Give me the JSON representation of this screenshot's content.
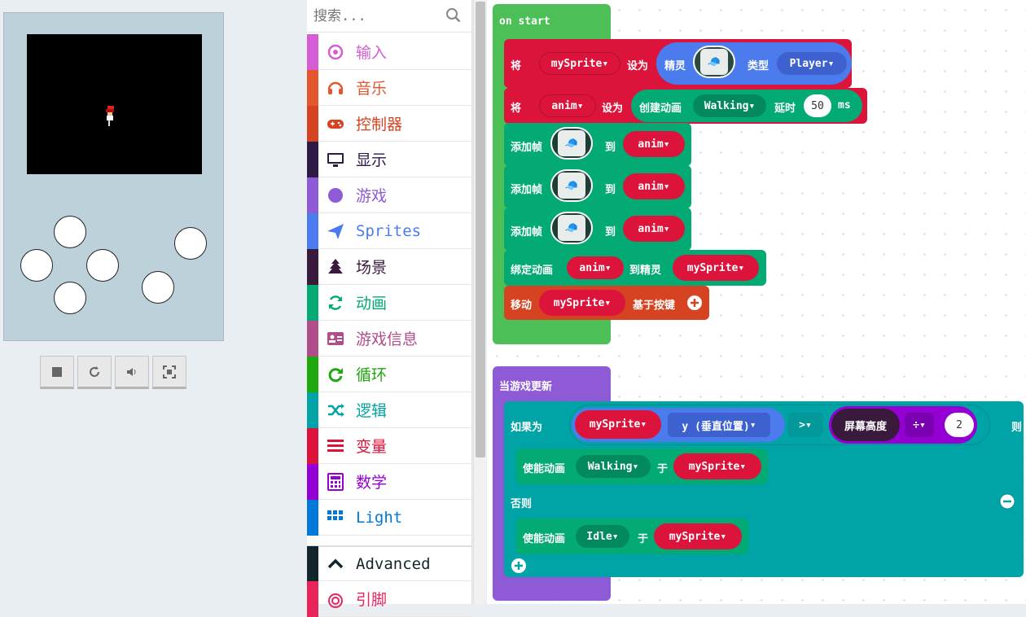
{
  "search": {
    "placeholder": "搜索..."
  },
  "categories": [
    {
      "label": "输入",
      "color": "#d65cd6",
      "icon": "target-icon"
    },
    {
      "label": "音乐",
      "color": "#e4572e",
      "icon": "headphones-icon"
    },
    {
      "label": "控制器",
      "color": "#d54322",
      "icon": "gamepad-icon"
    },
    {
      "label": "显示",
      "color": "#2d1a45",
      "icon": "monitor-icon"
    },
    {
      "label": "游戏",
      "color": "#8e5ad6",
      "icon": "circle-icon"
    },
    {
      "label": "Sprites",
      "color": "#4b7bec",
      "icon": "paper-plane-icon"
    },
    {
      "label": "场景",
      "color": "#3a1a3c",
      "icon": "tree-icon"
    },
    {
      "label": "动画",
      "color": "#03aa74",
      "icon": "refresh-icon"
    },
    {
      "label": "游戏信息",
      "color": "#b04d8a",
      "icon": "id-card-icon"
    },
    {
      "label": "循环",
      "color": "#20a810",
      "icon": "loop-icon"
    },
    {
      "label": "逻辑",
      "color": "#00a4a6",
      "icon": "shuffle-icon"
    },
    {
      "label": "变量",
      "color": "#dc143c",
      "icon": "list-icon"
    },
    {
      "label": "数学",
      "color": "#9400d3",
      "icon": "calculator-icon"
    },
    {
      "label": "Light",
      "color": "#0078d7",
      "icon": "grid-icon"
    },
    {
      "label": "Advanced",
      "color": "#13252a",
      "icon": "chevron-up-icon"
    },
    {
      "label": "引脚",
      "color": "#e9245a",
      "icon": "pin-icon"
    }
  ],
  "blocks": {
    "on_start": "on start",
    "set": "将",
    "my_sprite": "mySprite",
    "set_to": "设为",
    "sprite": "精灵",
    "kind": "类型",
    "player": "Player",
    "anim": "anim",
    "create_anim": "创建动画",
    "walking": "Walking",
    "delay": "延时",
    "delay_val": "50",
    "ms": "ms",
    "add_frame": "添加帧",
    "to": "到",
    "attach": "绑定动画",
    "to_sprite": "到精灵",
    "move": "移动",
    "by_buttons": "基于按键",
    "on_update": "当游戏更新",
    "if": "如果为",
    "y_pos": "y (垂直位置)",
    "gt": ">",
    "screen_h": "屏幕高度",
    "div": "÷",
    "two": "2",
    "then": "则",
    "enable_anim": "使能动画",
    "on": "于",
    "else": "否则",
    "idle": "Idle"
  },
  "colors": {
    "start": "#4cbf56",
    "game_update": "#8e5ad6",
    "var": "#dc143c",
    "anim": "#03aa74",
    "logic": "#00a4a6",
    "sprites": "#4b7bec",
    "ctrl": "#d54322"
  }
}
